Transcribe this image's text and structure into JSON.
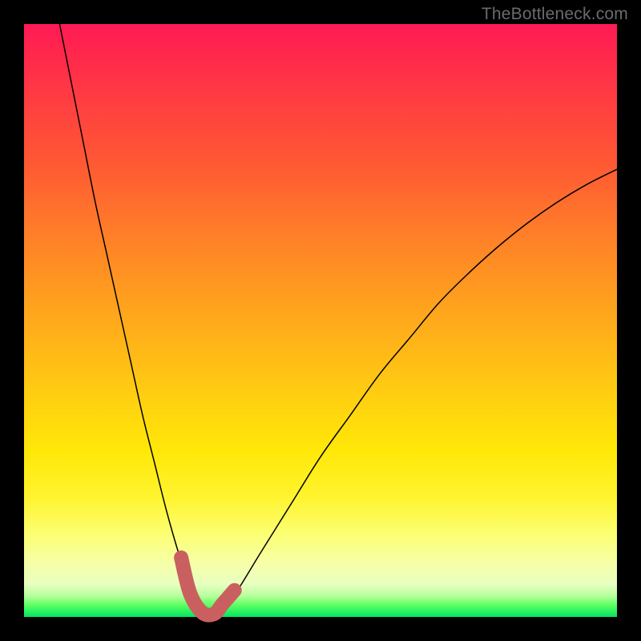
{
  "watermark": "TheBottleneck.com",
  "chart_data": {
    "type": "line",
    "title": "",
    "xlabel": "",
    "ylabel": "",
    "xlim": [
      0,
      100
    ],
    "ylim": [
      0,
      100
    ],
    "grid": false,
    "legend": false,
    "series": [
      {
        "name": "bottleneck-curve",
        "x": [
          6,
          8,
          10,
          12,
          14,
          16,
          18,
          20,
          22,
          24,
          26,
          28,
          30,
          32,
          35,
          40,
          45,
          50,
          55,
          60,
          65,
          70,
          75,
          80,
          85,
          90,
          95,
          100
        ],
        "y": [
          100,
          90,
          80,
          70,
          61,
          52,
          43,
          34,
          26,
          18,
          11,
          5,
          1,
          0,
          3,
          11,
          19,
          27,
          34,
          41,
          47,
          53,
          58,
          62.5,
          66.5,
          70,
          73,
          75.5
        ]
      }
    ],
    "highlight": {
      "name": "optimal-range-marker",
      "x": [
        26.5,
        28,
        30,
        32,
        33.5,
        35.5
      ],
      "y": [
        10,
        4,
        0.8,
        0.5,
        2.2,
        4.5
      ],
      "color": "#c9605f"
    }
  }
}
